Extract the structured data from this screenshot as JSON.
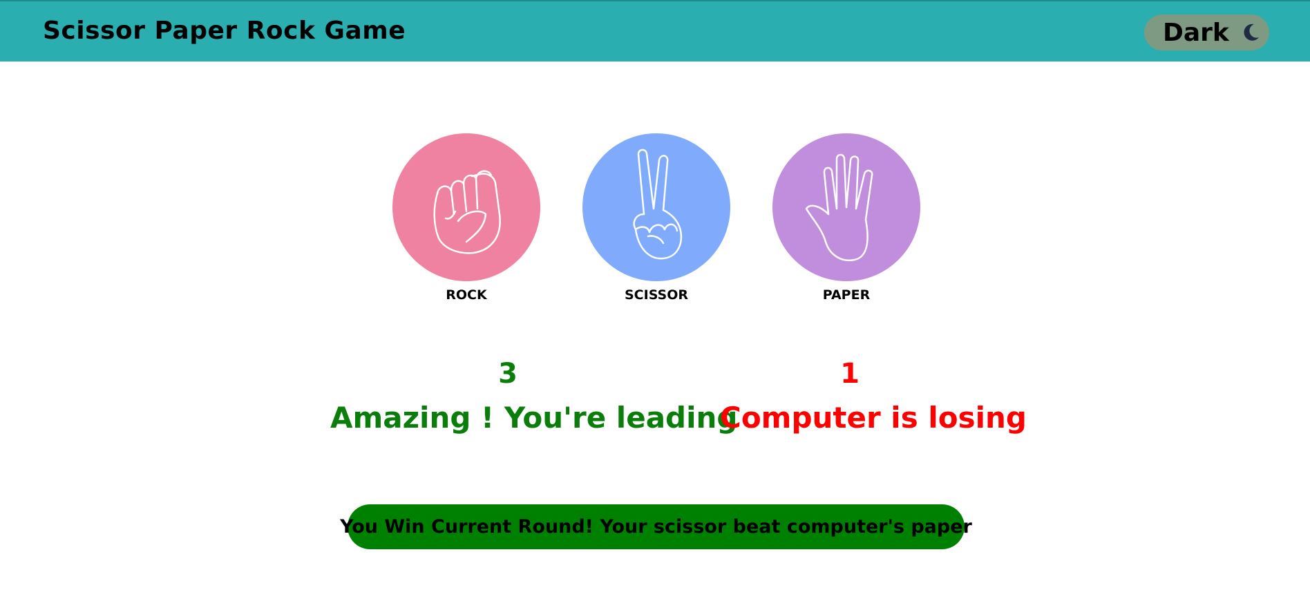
{
  "header": {
    "title": "Scissor Paper Rock Game",
    "theme_toggle_label": "Dark",
    "theme_icon": "moon-icon"
  },
  "colors": {
    "navbar": "#2aaeb0",
    "toggle": "#7e9a83",
    "rock": "#ee82a0",
    "scissor": "#80aafc",
    "paper": "#c08edc",
    "win": "#0a7d0a",
    "lose": "#ff0000",
    "result_bg": "#008000"
  },
  "choices": [
    {
      "label": "ROCK",
      "icon": "fist-icon"
    },
    {
      "label": "SCISSOR",
      "icon": "peace-hand-icon"
    },
    {
      "label": "PAPER",
      "icon": "open-hand-icon"
    }
  ],
  "scores": {
    "user": "3",
    "computer": "1",
    "user_status": "Amazing ! You're leading",
    "computer_status": "Computer is losing"
  },
  "result": {
    "message": "You Win Current Round! Your scissor beat computer's paper"
  }
}
